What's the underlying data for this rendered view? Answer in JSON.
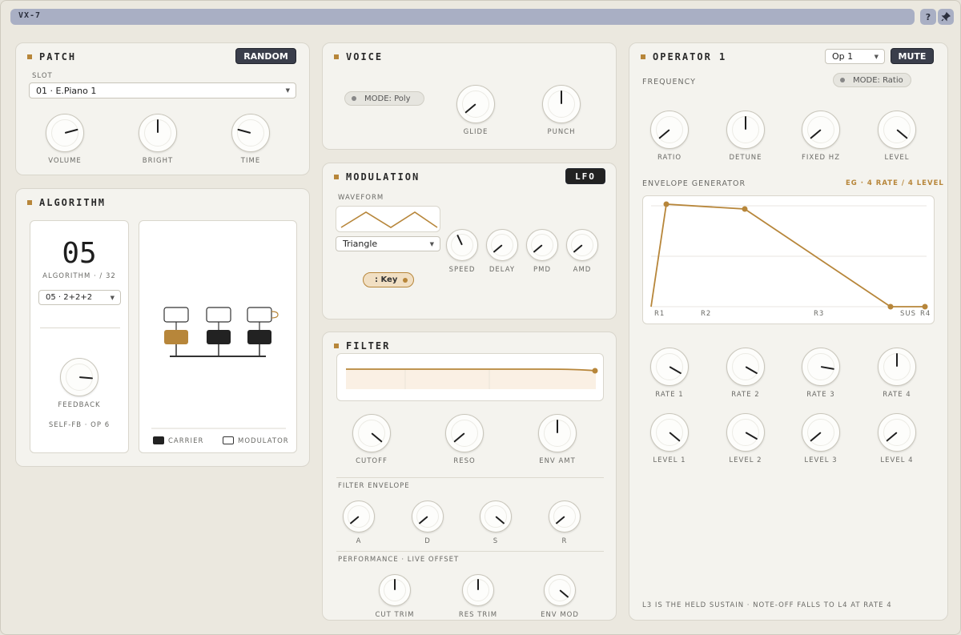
{
  "app": {
    "title": "VX-7",
    "help": "?",
    "pin": "📌"
  },
  "patch": {
    "title": "PATCH",
    "random_label": "RANDOM",
    "slot_label": "SLOT",
    "slot_value": "01 · E.Piano 1",
    "knobs": [
      {
        "label": "VOLUME",
        "angle": 75
      },
      {
        "label": "BRIGHT",
        "angle": 0
      },
      {
        "label": "TIME",
        "angle": -75
      }
    ]
  },
  "voice": {
    "title": "VOICE",
    "mode_label": "MODE: Poly",
    "knobs": [
      {
        "label": "GLIDE",
        "angle": -130
      },
      {
        "label": "PUNCH",
        "angle": 0
      }
    ]
  },
  "modulation": {
    "title": "MODULATION",
    "lfo_label": "LFO",
    "waveform_label": "WAVEFORM",
    "waveform_value": "Triangle",
    "key_label": ": Key",
    "knobs": [
      {
        "label": "SPEED",
        "angle": -25
      },
      {
        "label": "DELAY",
        "angle": -130
      },
      {
        "label": "PMD",
        "angle": -130
      },
      {
        "label": "AMD",
        "angle": -130
      }
    ]
  },
  "filter": {
    "title": "FILTER",
    "knobs": [
      {
        "label": "CUTOFF",
        "angle": 130
      },
      {
        "label": "RESO",
        "angle": -130
      },
      {
        "label": "ENV AMT",
        "angle": 0
      }
    ],
    "env_label": "FILTER ENVELOPE",
    "env_knobs": [
      {
        "label": "A",
        "angle": -130
      },
      {
        "label": "D",
        "angle": -130
      },
      {
        "label": "S",
        "angle": 130
      },
      {
        "label": "R",
        "angle": -130
      }
    ],
    "perf_label": "PERFORMANCE · LIVE OFFSET",
    "perf_knobs": [
      {
        "label": "CUT TRIM",
        "angle": 0
      },
      {
        "label": "RES TRIM",
        "angle": 0
      },
      {
        "label": "ENV MOD",
        "angle": 130
      }
    ]
  },
  "algorithm": {
    "title": "ALGORITHM",
    "number": "05",
    "sub_label": "ALGORITHM · / 32",
    "select_value": "05 · 2+2+2",
    "feedback_label": "FEEDBACK",
    "feedback_angle": 95,
    "selffb_label": "SELF-FB · OP 6",
    "carrier_label": "CARRIER",
    "modulator_label": "MODULATOR"
  },
  "operator": {
    "title": "OPERATOR 1",
    "op_select": "Op 1",
    "mute_label": "MUTE",
    "frequency_label": "FREQUENCY",
    "mode_label": "MODE: Ratio",
    "freq_knobs": [
      {
        "label": "RATIO",
        "angle": -130
      },
      {
        "label": "DETUNE",
        "angle": 0
      },
      {
        "label": "FIXED HZ",
        "angle": -130
      },
      {
        "label": "LEVEL",
        "angle": 130
      }
    ],
    "eg_label": "ENVELOPE GENERATOR",
    "eg_info": "EG · 4 RATE / 4 LEVEL",
    "eg_points": [
      "R1",
      "R2",
      "R3",
      "SUS",
      "R4"
    ],
    "rate_knobs": [
      {
        "label": "RATE 1",
        "angle": 120
      },
      {
        "label": "RATE 2",
        "angle": 120
      },
      {
        "label": "RATE 3",
        "angle": 100
      },
      {
        "label": "RATE 4",
        "angle": 0
      }
    ],
    "level_knobs": [
      {
        "label": "LEVEL 1",
        "angle": 130
      },
      {
        "label": "LEVEL 2",
        "angle": 120
      },
      {
        "label": "LEVEL 3",
        "angle": -130
      },
      {
        "label": "LEVEL 4",
        "angle": -130
      }
    ],
    "footer": "L3 IS THE HELD SUSTAIN · NOTE-OFF FALLS TO L4 AT RATE 4"
  },
  "colors": {
    "accent": "#b7863a",
    "dark": "#3a3e4b",
    "panel": "#f4f3ee"
  }
}
